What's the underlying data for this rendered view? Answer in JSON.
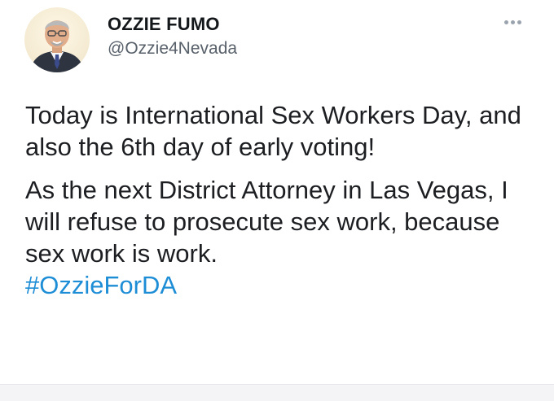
{
  "tweet": {
    "author": {
      "display_name": "OZZIE FUMO",
      "handle": "@Ozzie4Nevada",
      "avatar": "profile-photo"
    },
    "more_menu_icon": "more-horizontal-icon",
    "paragraphs": [
      "Today is International Sex Workers Day, and also the 6th day of early voting!",
      "As the next District Attorney in Las Vegas, I will refuse to prosecute sex work, because sex work is work."
    ],
    "hashtag": "#OzzieForDA"
  },
  "colors": {
    "text": "#1c1e21",
    "handle": "#586069",
    "link": "#1d8dd6",
    "background": "#ffffff"
  }
}
